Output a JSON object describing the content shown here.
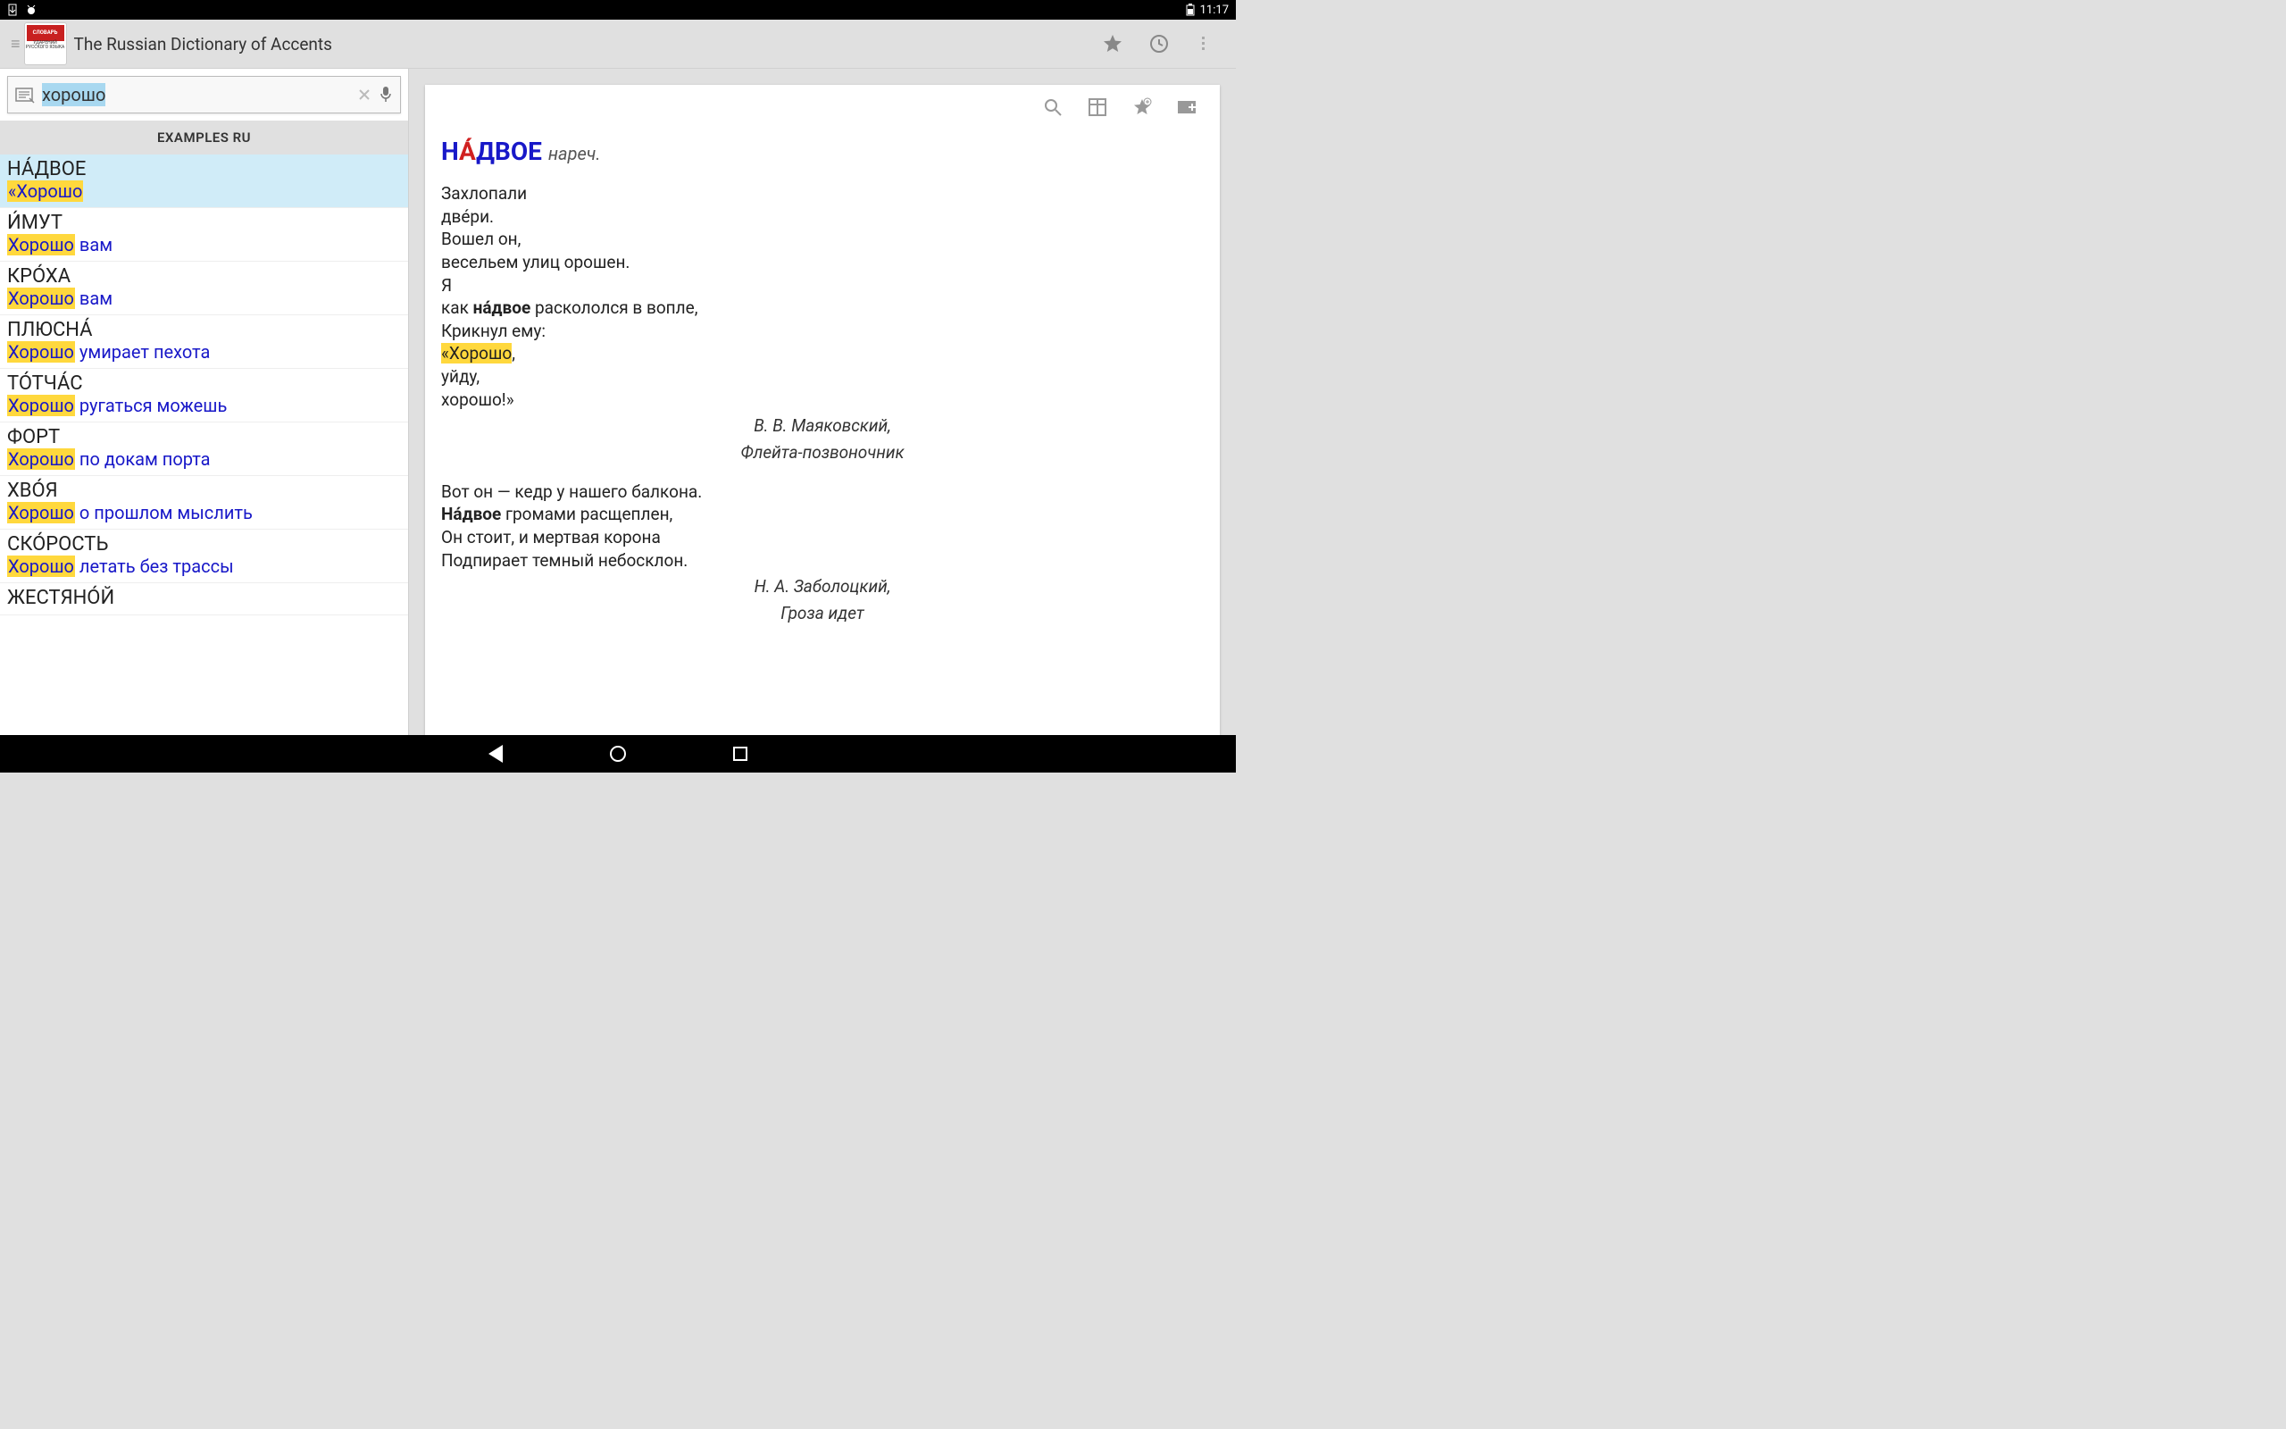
{
  "statusbar": {
    "time": "11:17"
  },
  "header": {
    "title": "The Russian Dictionary of Accents",
    "logo_line1": "СЛОВАРЬ",
    "logo_line2": "УДАРЕНИЙ РУССКОГО ЯЗЫКА"
  },
  "search": {
    "value": "хорошо"
  },
  "section_header": "EXAMPLES RU",
  "results": [
    {
      "head": "НА́ДВОЕ",
      "hl": "«Хорошо",
      "rest": "",
      "selected": true
    },
    {
      "head": "И́МУТ",
      "hl": "Хорошо",
      "rest": " вам"
    },
    {
      "head": "КРО́ХА",
      "hl": "Хорошо",
      "rest": " вам"
    },
    {
      "head": "ПЛЮСНА́",
      "hl": "Хорошо",
      "rest": " умирает пехота"
    },
    {
      "head": "ТО́ТЧА́С",
      "hl": "Хорошо",
      "rest": " ругаться можешь"
    },
    {
      "head": "ФОРТ",
      "hl": "Хорошо",
      "rest": " по докам порта"
    },
    {
      "head": "ХВО́Я",
      "hl": "Хорошо",
      "rest": " о прошлом мыслить"
    },
    {
      "head": "СКО́РОСТЬ",
      "hl": "Хорошо",
      "rest": " летать без трассы"
    },
    {
      "head": "ЖЕСТЯНО́Й",
      "hl": "",
      "rest": ""
    }
  ],
  "article": {
    "headword_pre": "Н",
    "headword_accent": "А́",
    "headword_post": "ДВОЕ",
    "pos": "нареч.",
    "poem1_lines": [
      "Захлопали",
      "две́ри.",
      "Вошел он,",
      "весельем улиц орошен.",
      "Я"
    ],
    "poem1_bold_pre": "как ",
    "poem1_bold": "на́двое",
    "poem1_bold_post": " раскололся в вопле,",
    "poem1_line_after": "Крикнул ему:",
    "poem1_hl": "«Хорошо",
    "poem1_hl_after": ",",
    "poem1_tail": [
      "уйду,",
      "хорошо!»"
    ],
    "citation1_author": "В. В. Маяковский,",
    "citation1_work": "Флейта-позвоночник",
    "poem2_line1": "Вот он — кедр у нашего балкона.",
    "poem2_bold": "На́двое",
    "poem2_bold_post": " громами расщеплен,",
    "poem2_tail": [
      "Он стоит, и мертвая корона",
      "Подпирает темный небосклон."
    ],
    "citation2_author": "Н. А. Заболоцкий,",
    "citation2_work": "Гроза идет"
  }
}
